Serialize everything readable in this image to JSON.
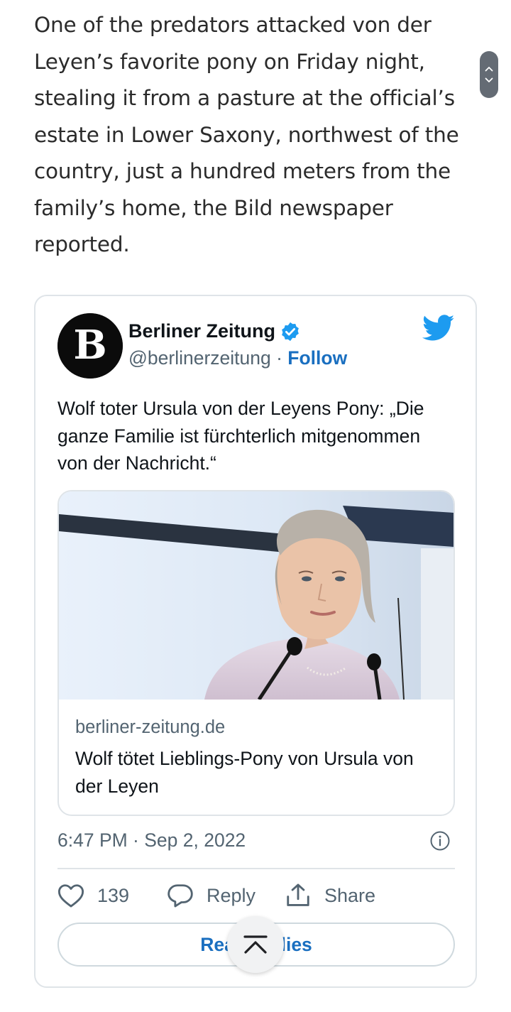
{
  "article": {
    "paragraph": "One of the predators attacked von der Leyen’s favorite pony on Friday night, stealing it from a pasture at the official’s estate in Lower Saxony, northwest of the country, just a hundred meters from the family’s home, the Bild newspaper reported."
  },
  "tweet": {
    "author_name": "Berliner Zeitung",
    "handle": "@berlinerzeitung",
    "separator": " · ",
    "follow_label": "Follow",
    "avatar_letter": "B",
    "text": "Wolf toter Ursula von der Leyens Pony: „Die ganze Familie ist fürchterlich mitgenommen von der Nachricht.“",
    "link_card": {
      "domain": "berliner-zeitung.de",
      "title": "Wolf tötet Lieblings-Pony von Ursula von der Leyen"
    },
    "timestamp": "6:47 PM · Sep 2, 2022",
    "like_count": "139",
    "reply_label": "Reply",
    "share_label": "Share",
    "read_replies_label": "Read replies"
  },
  "colors": {
    "link_blue": "#1a6fc0",
    "twitter_blue": "#1d9bf0",
    "verified_blue": "#1d9bf0",
    "muted_text": "#536471",
    "border": "#dfe4e8"
  },
  "icons": {
    "scroll_up": "chevron-up-icon",
    "scroll_down": "chevron-down-icon",
    "verified": "verified-badge-icon",
    "twitter": "twitter-bird-icon",
    "info": "info-icon",
    "like": "heart-icon",
    "reply": "reply-bubble-icon",
    "share": "share-icon",
    "scroll_top": "scroll-to-top-icon"
  }
}
